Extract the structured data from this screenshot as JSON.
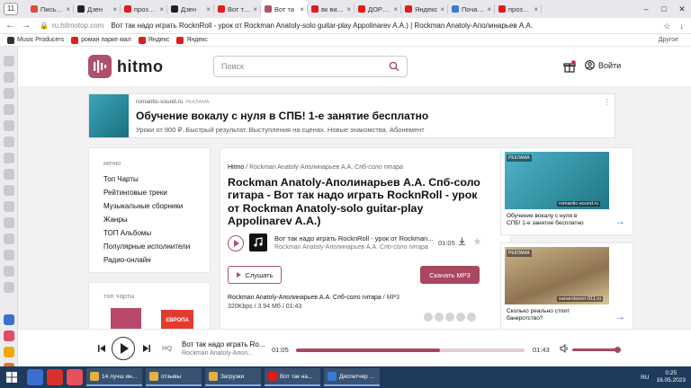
{
  "browser": {
    "tab_counter": "11",
    "tabs": [
      {
        "title": "Письмо",
        "color": "#e04b3c"
      },
      {
        "title": "Дзен",
        "color": "#222222"
      },
      {
        "title": "проза ру",
        "color": "#e21b1b"
      },
      {
        "title": "Дзен",
        "color": "#222222"
      },
      {
        "title": "Вот так н",
        "color": "#e21b1b"
      },
      {
        "title": "Вот та",
        "color": "#b0506c",
        "active": true
      },
      {
        "title": "вк видео",
        "color": "#e21b1b"
      },
      {
        "title": "ДОРОГА",
        "color": "#e21b1b"
      },
      {
        "title": "Яндекс",
        "color": "#e21b1b"
      },
      {
        "title": "Почасов",
        "color": "#3a7bd5"
      },
      {
        "title": "проза ру",
        "color": "#e21b1b"
      }
    ],
    "host": "ru.hitmotop.com",
    "page_title": "Вот так надо играть RocknRoll - урок от Rockman Anatoly-solo guitar-play Appolinarev A.A.) | Rockman Anatoly-Аполинарьев А.А. С...",
    "bookmarks": [
      {
        "label": "Music Producers",
        "color": "#333333"
      },
      {
        "label": "роман парке мал",
        "color": "#e21b1b"
      },
      {
        "label": "Яндекс",
        "color": "#e21b1b"
      },
      {
        "label": "Яндекс",
        "color": "#e21b1b"
      }
    ],
    "bookmarks_more": "Другое"
  },
  "site": {
    "logo_text": "hitmo",
    "search_placeholder": "Поиск",
    "notif_count": "0",
    "login": "Войти",
    "brand_color": "#a8475f"
  },
  "ad_top": {
    "source": "romantic-sound.ru",
    "source_tag": "РЕКЛАМА",
    "title": "Обучение вокалу с нуля в СПБ! 1-е занятие бесплатно",
    "desc": "Уроки от 900 ₽. Быстрый результат. Выступления на сценах. Новые знакомства. Абонемент"
  },
  "menu": {
    "label": "меню",
    "items": [
      "Топ Чарты",
      "Рейтинговые треки",
      "Музыкальные сборники",
      "Жанры",
      "ТОП Альбомы",
      "Популярные исполнители",
      "Радио-онлайн"
    ]
  },
  "topcharts": {
    "label": "топ чарты",
    "badge": "ЕВРОПА ПЛЮС"
  },
  "main": {
    "crumb_home": "Hitmo",
    "crumb_sep": "/",
    "crumb_current": "Rockman Anatoly-Аполинарьев А.А. Спб-соло гитара",
    "title": "Rockman Anatoly-Аполинарьев А.А. Спб-соло гитара - Вот так надо играть RocknRoll - урок от Rockman Anatoly-solo guitar-play Appolinarev A.A.)",
    "track_title": "Вот так надо играть RocknRoll - урок от Rockman...",
    "track_artist": "Rockman Anatoly-Аполинарьев А.А. Спб-соло гитара",
    "track_duration": "01:05",
    "listen_label": "Слушать",
    "download_label": "Скачать MP3",
    "meta_artist": "Rockman Anatoly-Аполинарьев А.А. Спб-соло гитара",
    "meta_info": " / MP3 320Kbps / 3.94 Мб / 01:43",
    "rating_stars": 5
  },
  "right_ads": [
    {
      "tag": "РЕКЛАМА",
      "source": "romantic-sound.ru",
      "caption": "Обучение вокалу с нуля в СПБ! 1-е занятие бесплатно"
    },
    {
      "tag": "РЕКЛАМА",
      "source": "sanarotsoon-911.ru",
      "caption": "Сколько реально стоит банкротство?"
    }
  ],
  "player": {
    "hq": "HQ",
    "title": "Вот так надо играть Ro...",
    "artist": "Rockman Anatoly-Апол...",
    "current_time": "01:05",
    "total_time": "01:43",
    "progress": 0.63,
    "volume": 1.0
  },
  "taskbar": {
    "windows": [
      {
        "label": "14 лучш ин...",
        "color": "#e3b341"
      },
      {
        "label": "отзывы",
        "color": "#e3b341"
      },
      {
        "label": "Загрузки",
        "color": "#e3b341"
      },
      {
        "label": "Вот так на...",
        "color": "#e21b1b"
      },
      {
        "label": "Диспетчер ...",
        "color": "#3a7bd5"
      }
    ],
    "lang": "RU",
    "time": "0:25",
    "date": "16.05.2023"
  }
}
